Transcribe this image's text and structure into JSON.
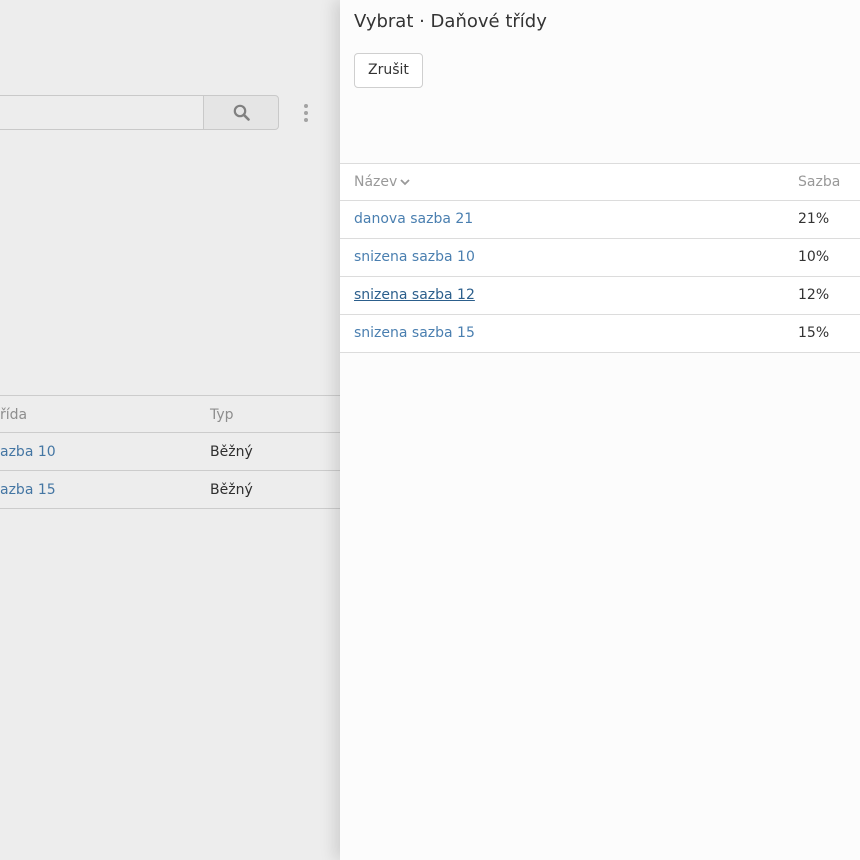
{
  "background": {
    "table": {
      "headers": {
        "class": "řída",
        "type": "Typ"
      },
      "rows": [
        {
          "class": "azba 10",
          "type": "Běžný"
        },
        {
          "class": "azba 15",
          "type": "Běžný"
        }
      ]
    }
  },
  "panel": {
    "title": "Vybrat · Daňové třídy",
    "cancel_label": "Zrušit",
    "columns": {
      "name": "Název",
      "rate": "Sazba"
    },
    "rows": [
      {
        "name": "danova sazba 21",
        "rate": "21%"
      },
      {
        "name": "snizena sazba 10",
        "rate": "10%"
      },
      {
        "name": "snizena sazba 12",
        "rate": "12%"
      },
      {
        "name": "snizena sazba 15",
        "rate": "15%"
      }
    ],
    "hovered_row": "snizena sazba 12"
  },
  "icons": {
    "search": "search-icon",
    "kebab": "kebab-menu-icon",
    "sort": "chevron-down-icon"
  },
  "colors": {
    "link": "#4a7fb0",
    "link_hover": "#2c5f8c",
    "muted": "#999999"
  }
}
